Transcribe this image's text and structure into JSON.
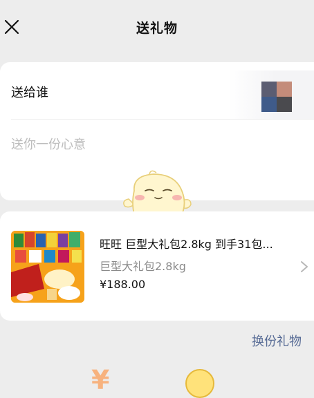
{
  "header": {
    "title": "送礼物",
    "close_icon": "close-icon"
  },
  "recipient": {
    "label": "送给谁",
    "avatar_icon": "avatar-icon",
    "avatar_colors": [
      "#5b5d72",
      "#c48c7a",
      "#3f5b8a",
      "#4a4a4e"
    ]
  },
  "message": {
    "value": "",
    "placeholder": "送你一份心意"
  },
  "mascot": {
    "icon": "mascot-sticker-icon"
  },
  "product": {
    "name": "旺旺 巨型大礼包2.8kg 到手31包...",
    "spec": "巨型大礼包2.8kg",
    "price": "¥188.00",
    "image_icon": "snack-gift-pack-image",
    "chevron_icon": "chevron-right-icon"
  },
  "actions": {
    "change_gift": "换份礼物"
  },
  "colors": {
    "background": "#ededed",
    "card": "#ffffff",
    "link": "#576b95",
    "placeholder": "#bdbdbd",
    "price_highlight": "#f7b27e"
  }
}
